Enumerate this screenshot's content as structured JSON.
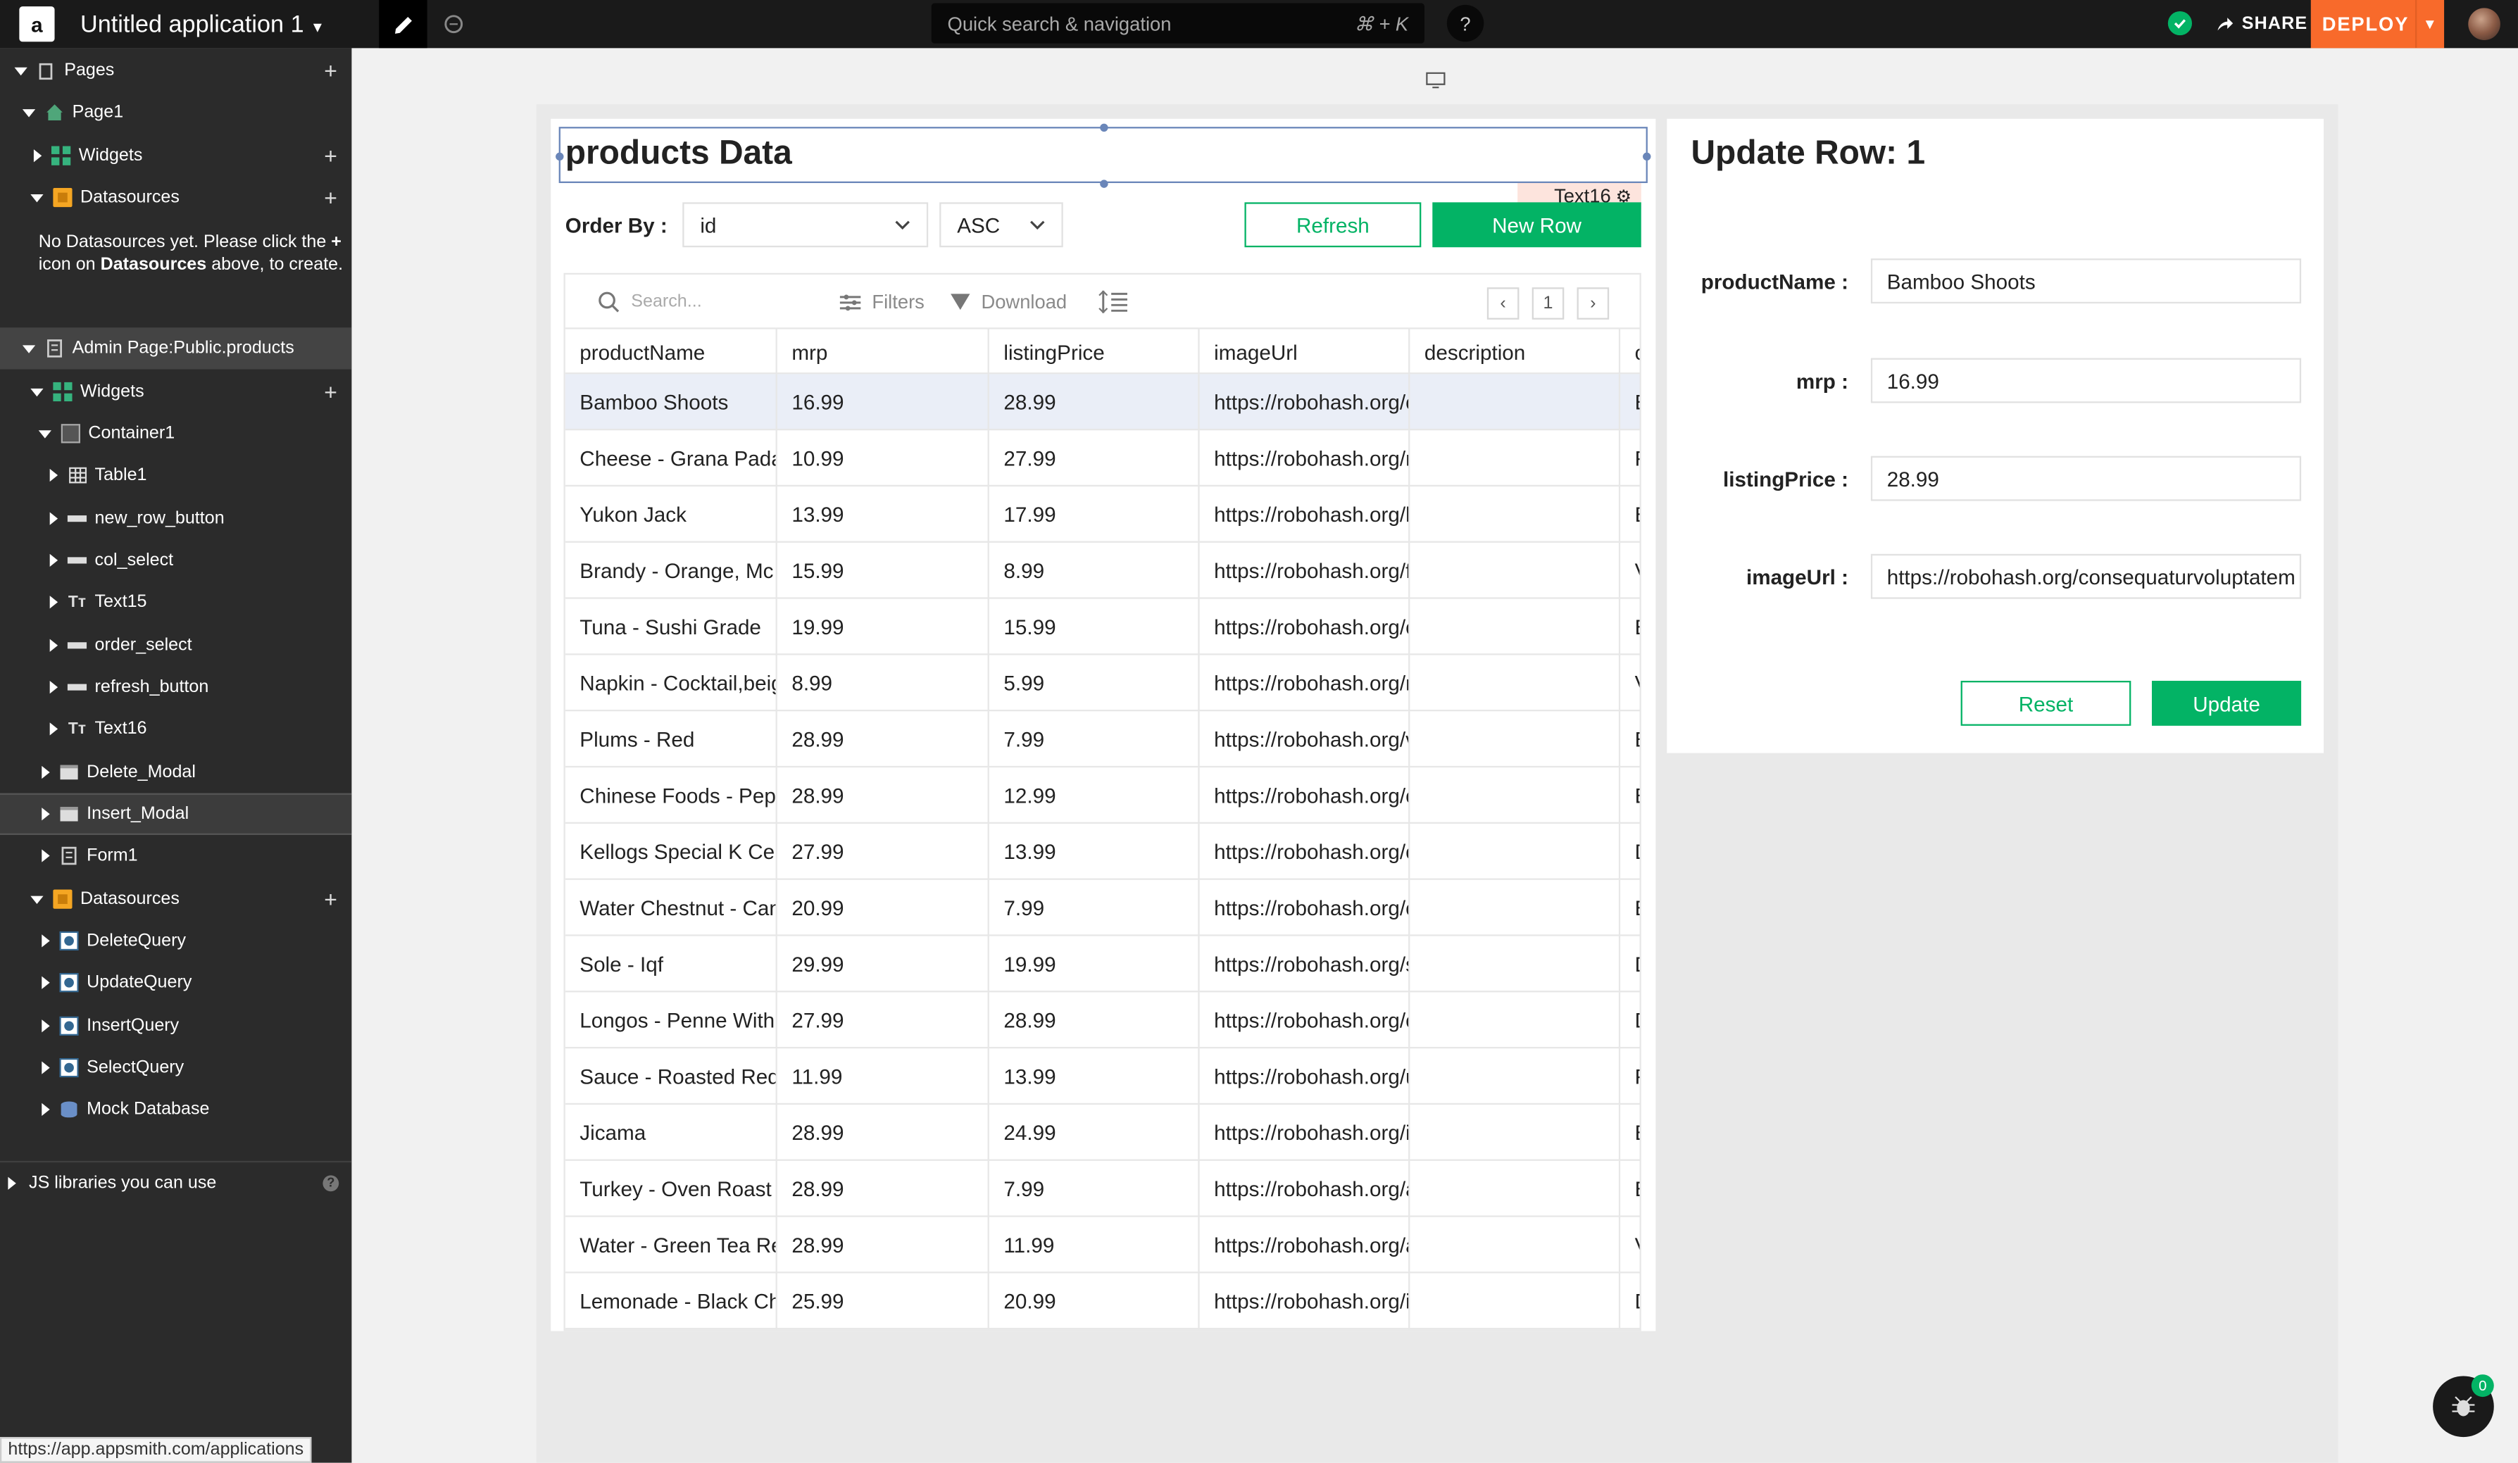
{
  "header": {
    "logo_letter": "a",
    "app_title": "Untitled application 1",
    "search_placeholder": "Quick search & navigation",
    "search_shortcut": "⌘ + K",
    "help": "?",
    "share": "SHARE",
    "deploy": "DEPLOY"
  },
  "sidebar": {
    "pages": "Pages",
    "page1": "Page1",
    "widgets": "Widgets",
    "datasources": "Datasources",
    "ds_note_1": "No Datasources yet. Please click the",
    "ds_note_plus": "+",
    "ds_note_2": " icon on ",
    "ds_note_bold": "Datasources",
    "ds_note_3": " above, to create.",
    "admin_page": "Admin Page:Public.products",
    "items": [
      "Container1",
      "Table1",
      "new_row_button",
      "col_select",
      "Text15",
      "order_select",
      "refresh_button",
      "Text16",
      "Delete_Modal",
      "Insert_Modal",
      "Form1"
    ],
    "queries": [
      "DeleteQuery",
      "UpdateQuery",
      "InsertQuery",
      "SelectQuery",
      "Mock Database"
    ],
    "js_libs": "JS libraries you can use"
  },
  "status_url": "https://app.appsmith.com/applications",
  "canvas": {
    "title": "products Data",
    "widget_tag": "Text16",
    "order_by_label": "Order By :",
    "order_col": "id",
    "order_dir": "ASC",
    "refresh": "Refresh",
    "new_row": "New Row"
  },
  "table": {
    "search_placeholder": "Search...",
    "filters": "Filters",
    "download": "Download",
    "page_number": "1",
    "columns": [
      "productName",
      "mrp",
      "listingPrice",
      "imageUrl",
      "description",
      "c"
    ],
    "rows": [
      [
        "Bamboo Shoots",
        "16.99",
        "28.99",
        "https://robohash.org/c",
        "",
        "E"
      ],
      [
        "Cheese - Grana Padano",
        "10.99",
        "27.99",
        "https://robohash.org/n",
        "",
        "F"
      ],
      [
        "Yukon Jack",
        "13.99",
        "17.99",
        "https://robohash.org/l",
        "",
        "E"
      ],
      [
        "Brandy - Orange, Mc",
        "15.99",
        "8.99",
        "https://robohash.org/f",
        "",
        "V"
      ],
      [
        "Tuna - Sushi Grade",
        "19.99",
        "15.99",
        "https://robohash.org/c",
        "",
        "E"
      ],
      [
        "Napkin - Cocktail,beige",
        "8.99",
        "5.99",
        "https://robohash.org/n",
        "",
        "V"
      ],
      [
        "Plums - Red",
        "28.99",
        "7.99",
        "https://robohash.org/v",
        "",
        "E"
      ],
      [
        "Chinese Foods - Pepper",
        "28.99",
        "12.99",
        "https://robohash.org/c",
        "",
        "E"
      ],
      [
        "Kellogs Special K Cereal",
        "27.99",
        "13.99",
        "https://robohash.org/c",
        "",
        "D"
      ],
      [
        "Water Chestnut - Canned",
        "20.99",
        "7.99",
        "https://robohash.org/c",
        "",
        "E"
      ],
      [
        "Sole - Iqf",
        "29.99",
        "19.99",
        "https://robohash.org/s",
        "",
        "D"
      ],
      [
        "Longos - Penne With",
        "27.99",
        "28.99",
        "https://robohash.org/c",
        "",
        "D"
      ],
      [
        "Sauce - Roasted Red",
        "11.99",
        "13.99",
        "https://robohash.org/u",
        "",
        "F"
      ],
      [
        "Jicama",
        "28.99",
        "24.99",
        "https://robohash.org/i",
        "",
        "E"
      ],
      [
        "Turkey - Oven Roast Breast",
        "28.99",
        "7.99",
        "https://robohash.org/a",
        "",
        "E"
      ],
      [
        "Water - Green Tea Refresher",
        "28.99",
        "11.99",
        "https://robohash.org/a",
        "",
        "V"
      ],
      [
        "Lemonade - Black Cherry",
        "25.99",
        "20.99",
        "https://robohash.org/i",
        "",
        "D"
      ]
    ]
  },
  "form": {
    "title": "Update Row: 1",
    "fields": [
      {
        "label": "productName :",
        "value": "Bamboo Shoots"
      },
      {
        "label": "mrp :",
        "value": "16.99"
      },
      {
        "label": "listingPrice :",
        "value": "28.99"
      },
      {
        "label": "imageUrl :",
        "value": "https://robohash.org/consequaturvoluptatem"
      }
    ],
    "reset": "Reset",
    "update": "Update"
  },
  "debugger": {
    "count": "0"
  },
  "colors": {
    "accent": "#03b365",
    "deploy": "#f86a2b",
    "selection": "#6a86b9"
  }
}
